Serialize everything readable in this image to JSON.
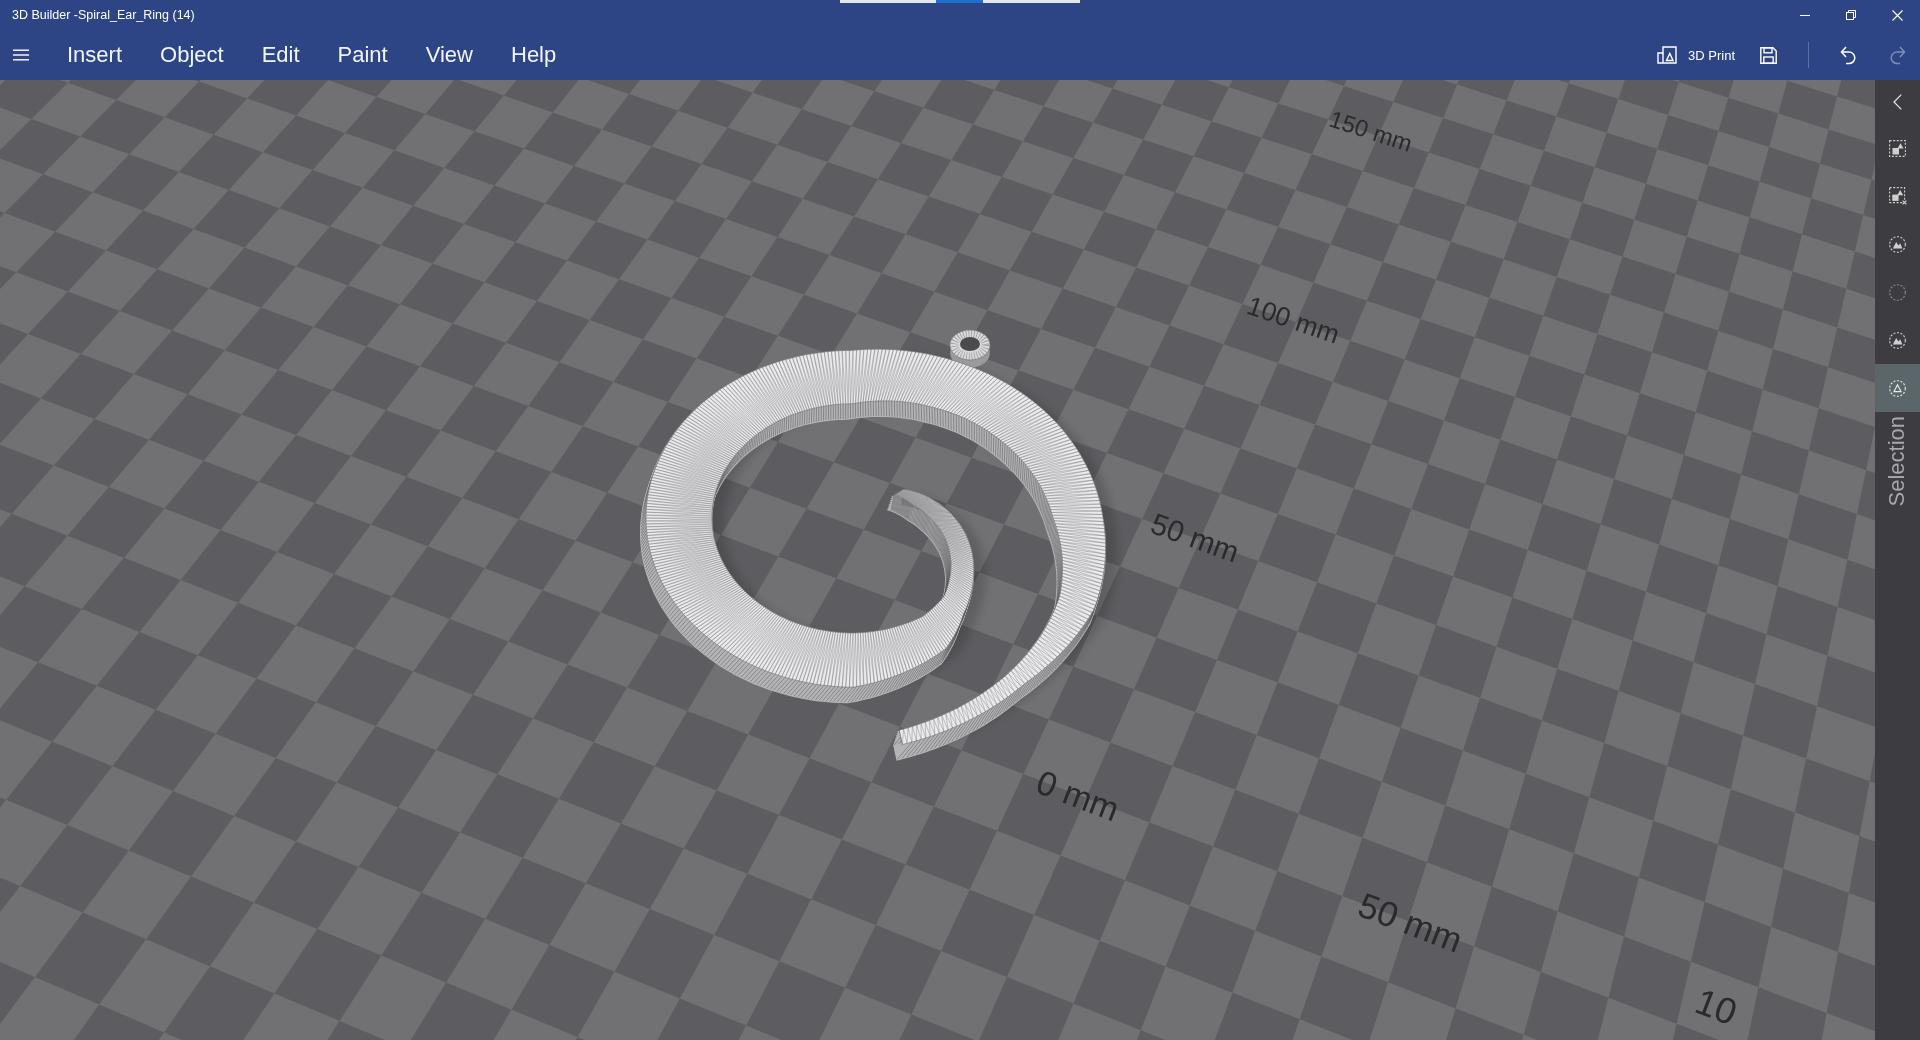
{
  "window": {
    "title": "3D Builder -Spiral_Ear_Ring (14)"
  },
  "menu": [
    "Insert",
    "Object",
    "Edit",
    "Paint",
    "View",
    "Help"
  ],
  "toolbar": [
    {
      "kind": "print",
      "label": "3D Print",
      "disabled": false
    },
    {
      "kind": "save",
      "disabled": false
    },
    {
      "kind": "undo",
      "disabled": false
    },
    {
      "kind": "redo",
      "disabled": true
    }
  ],
  "viewport": {
    "y_axis_labels": [
      "150 mm",
      "100 mm",
      "50 mm",
      "0 mm"
    ],
    "x_axis_labels": [
      "50 mm",
      "10"
    ]
  },
  "sidebar": {
    "tools": [
      {
        "kind": "frame",
        "selected": false
      },
      {
        "kind": "framecross",
        "selected": false
      },
      {
        "kind": "peaks",
        "selected": false
      },
      {
        "kind": "ring",
        "selected": false
      },
      {
        "kind": "peaks",
        "selected": false
      },
      {
        "kind": "triangle",
        "selected": true
      }
    ],
    "panel_label": "Selection"
  }
}
